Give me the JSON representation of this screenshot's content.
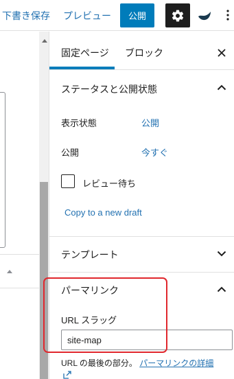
{
  "toolbar": {
    "save_draft": "下書き保存",
    "preview": "プレビュー",
    "publish": "公開",
    "icons": {
      "settings": "gear-icon",
      "plugin": "plugin-logo-icon",
      "more": "more-vertical-icon"
    },
    "accent_color": "#007cba"
  },
  "sidebar": {
    "tabs": [
      {
        "label": "固定ページ",
        "active": true
      },
      {
        "label": "ブロック",
        "active": false
      }
    ],
    "status_panel": {
      "title": "ステータスと公開状態",
      "expanded": true,
      "rows": [
        {
          "label": "表示状態",
          "value": "公開"
        },
        {
          "label": "公開",
          "value": "今すぐ"
        }
      ],
      "pending_review": {
        "label": "レビュー待ち",
        "checked": false
      },
      "copy_link": "Copy to a new draft"
    },
    "template_panel": {
      "title": "テンプレート",
      "expanded": false
    },
    "permalink_panel": {
      "title": "パーマリンク",
      "expanded": true,
      "slug_label": "URL スラッグ",
      "slug_value": "site-map",
      "help_text": "URL の最後の部分。",
      "help_link": "パーマリンクの詳細"
    }
  },
  "annotation_color": "#e0262c"
}
